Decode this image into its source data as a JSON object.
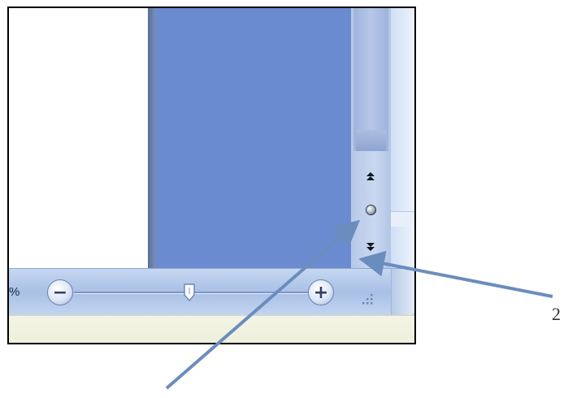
{
  "screenshot": {
    "status_bar": {
      "zoom_percent_text": "%",
      "zoom_out_symbol": "−",
      "zoom_in_symbol": "+",
      "zoom_out_icon": "zoom-out-icon",
      "zoom_in_icon": "zoom-in-icon"
    },
    "scrollbar": {
      "down_arrow_icon": "scroll-down-arrow-icon",
      "browse_previous_symbol": "⏶",
      "browse_object_icon": "select-browse-object-icon",
      "browse_next_symbol": "⏷"
    }
  },
  "annotation": {
    "callout_label": "2",
    "arrow_color": "#6a8dbd"
  }
}
